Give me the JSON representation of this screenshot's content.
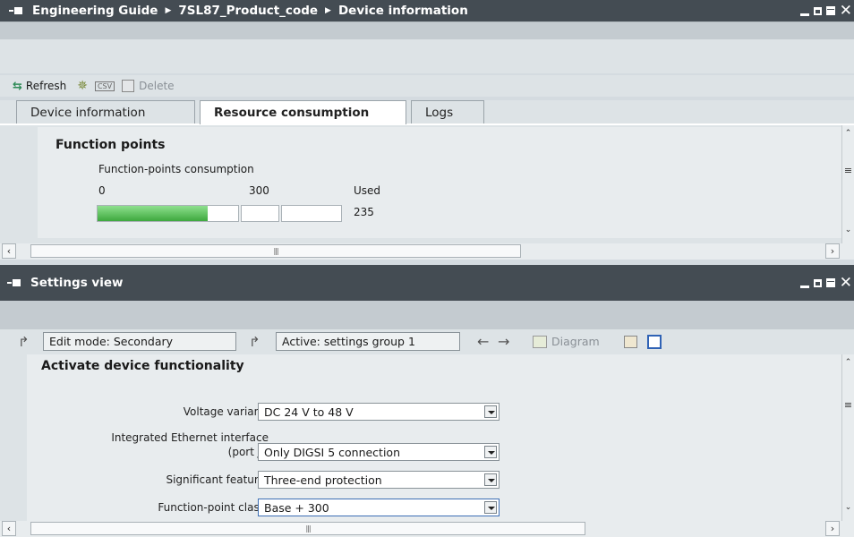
{
  "top_window": {
    "breadcrumb": [
      "Engineering Guide",
      "7SL87_Product_code",
      "Device information"
    ]
  },
  "toolbar": {
    "refresh_label": "Refresh",
    "csv_label": "CSV",
    "delete_label": "Delete"
  },
  "tabs": [
    {
      "label": "Device information",
      "active": false
    },
    {
      "label": "Resource consumption",
      "active": true
    },
    {
      "label": "Logs",
      "active": false
    }
  ],
  "function_points": {
    "heading": "Function points",
    "subheading": "Function-points consumption",
    "scale_min": "0",
    "scale_max": "300",
    "used_label": "Used",
    "used_value": "235",
    "used_fraction": 0.783,
    "bar_color": "#5cc05c"
  },
  "settings_window": {
    "title": "Settings view",
    "edit_mode": "Edit mode: Secondary",
    "active_group": "Active: settings group 1",
    "diagram_label": "Diagram"
  },
  "activate": {
    "heading": "Activate device functionality",
    "fields": [
      {
        "label": "Voltage variant:",
        "value": "DC 24 V to 48 V"
      },
      {
        "label_line1": "Integrated Ethernet interface",
        "label_line2": "(port J):",
        "value": "Only DIGSI 5 connection"
      },
      {
        "label": "Significant feature:",
        "value": "Three-end protection"
      },
      {
        "label": "Function-point class:",
        "value": "Base + 300"
      }
    ]
  }
}
